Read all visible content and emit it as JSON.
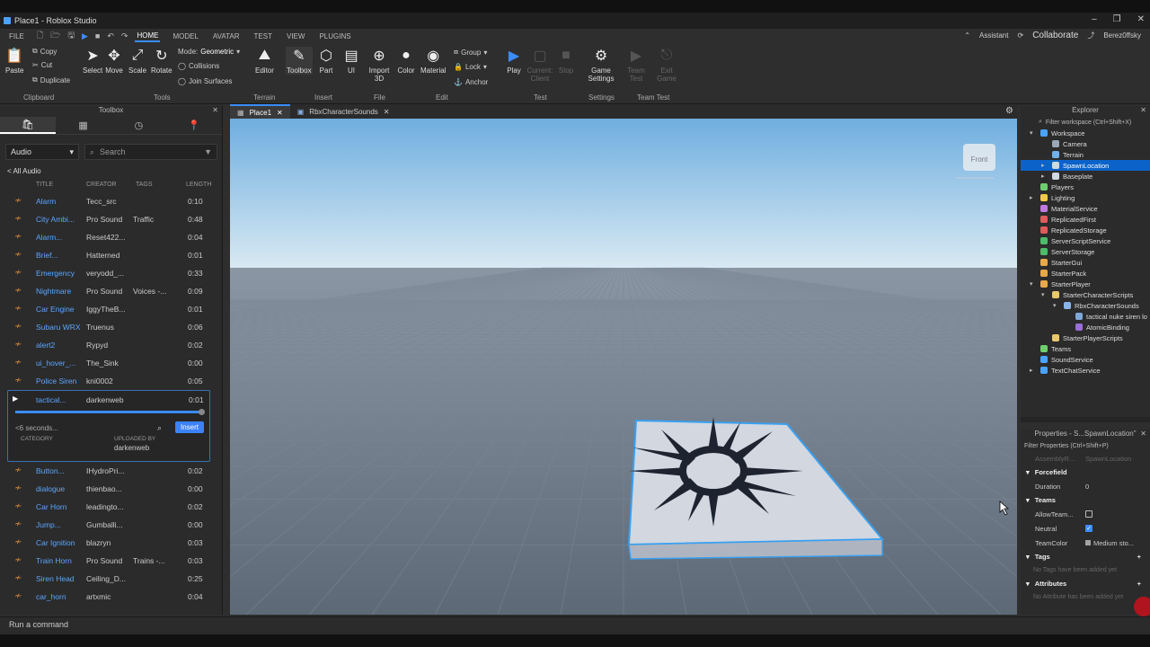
{
  "window": {
    "title": "Place1 - Roblox Studio"
  },
  "menu": {
    "items": [
      "FILE",
      "HOME",
      "MODEL",
      "AVATAR",
      "TEST",
      "VIEW",
      "PLUGINS"
    ],
    "active": "HOME",
    "assistant": "Assistant",
    "collaborate": "Collaborate",
    "user": "Berez0ffsky"
  },
  "ribbon": {
    "clipboard": {
      "paste": "Paste",
      "copy": "Copy",
      "cut": "Cut",
      "duplicate": "Duplicate",
      "group": "Clipboard"
    },
    "tools": {
      "select": "Select",
      "move": "Move",
      "scale": "Scale",
      "rotate": "Rotate",
      "mode_label": "Mode:",
      "mode_value": "Geometric",
      "collisions": "Collisions",
      "join_surfaces": "Join Surfaces",
      "group": "Tools"
    },
    "terrain": {
      "editor": "Editor",
      "group": "Terrain"
    },
    "insert": {
      "toolbox": "Toolbox",
      "part": "Part",
      "ui": "UI",
      "group": "Insert"
    },
    "file": {
      "import3d": "Import 3D",
      "group": "File"
    },
    "edit": {
      "color": "Color",
      "material": "Material",
      "group_btn": "Group",
      "lock": "Lock",
      "anchor": "Anchor",
      "group": "Edit"
    },
    "test": {
      "play": "Play",
      "current_client": "Current: Client",
      "stop": "Stop",
      "group": "Test"
    },
    "settings": {
      "game_settings": "Game Settings",
      "group": "Settings"
    },
    "team_test": {
      "team_test": "Team Test",
      "exit_game": "Exit Game",
      "group": "Team Test"
    }
  },
  "toolbox": {
    "title": "Toolbox",
    "category": "Audio",
    "search_placeholder": "Search",
    "breadcrumb": "< All Audio",
    "columns": [
      "TITLE",
      "CREATOR",
      "TAGS",
      "LENGTH"
    ],
    "rows_top": [
      {
        "title": "Alarm",
        "creator": "Tecc_src",
        "tags": "",
        "length": "0:10"
      },
      {
        "title": "City Ambi...",
        "creator": "Pro Sound",
        "tags": "Traffic",
        "length": "0:48"
      },
      {
        "title": "Alarm...",
        "creator": "Reset422...",
        "tags": "",
        "length": "0:04"
      },
      {
        "title": "Brief...",
        "creator": "Hatterned",
        "tags": "",
        "length": "0:01"
      },
      {
        "title": "Emergency",
        "creator": "veryodd_...",
        "tags": "",
        "length": "0:33"
      },
      {
        "title": "Nightmare",
        "creator": "Pro Sound",
        "tags": "Voices -...",
        "length": "0:09"
      },
      {
        "title": "Car Engine",
        "creator": "IggyTheB...",
        "tags": "",
        "length": "0:01"
      },
      {
        "title": "Subaru WRX",
        "creator": "Truenus",
        "tags": "",
        "length": "0:06"
      },
      {
        "title": "alert2",
        "creator": "Rypyd",
        "tags": "",
        "length": "0:02"
      },
      {
        "title": "ui_hover_...",
        "creator": "The_Sink",
        "tags": "",
        "length": "0:00"
      },
      {
        "title": "Police Siren",
        "creator": "kni0002",
        "tags": "",
        "length": "0:05"
      }
    ],
    "expanded": {
      "title": "tactical...",
      "creator": "darkenweb",
      "length": "0:01",
      "duration": "<6 seconds...",
      "insert": "Insert",
      "category_label": "CATEGORY",
      "uploaded_label": "UPLOADED BY",
      "uploaded_by": "darkenweb",
      "progress": 1.0
    },
    "rows_bottom": [
      {
        "title": "Button...",
        "creator": "IHydroPri...",
        "tags": "",
        "length": "0:02"
      },
      {
        "title": "dialogue",
        "creator": "thienbao...",
        "tags": "",
        "length": "0:00"
      },
      {
        "title": "Car Horn",
        "creator": "leadingto...",
        "tags": "",
        "length": "0:02"
      },
      {
        "title": "Jump...",
        "creator": "Gumballi...",
        "tags": "",
        "length": "0:00"
      },
      {
        "title": "Car Ignition",
        "creator": "blazryn",
        "tags": "",
        "length": "0:03"
      },
      {
        "title": "Train Horn",
        "creator": "Pro Sound",
        "tags": "Trains -...",
        "length": "0:03"
      },
      {
        "title": "Siren Head",
        "creator": "Ceiling_D...",
        "tags": "",
        "length": "0:25"
      },
      {
        "title": "car_horn",
        "creator": "artxmic",
        "tags": "",
        "length": "0:04"
      }
    ]
  },
  "doc_tabs": [
    "Place1",
    "RbxCharacterSounds"
  ],
  "viewport": {
    "view_cube": "Front"
  },
  "explorer": {
    "title": "Explorer",
    "filter": "Filter workspace (Ctrl+Shift+X)",
    "nodes": [
      {
        "label": "Workspace",
        "depth": 0,
        "arrow": "▾",
        "color": "#4aa3ff"
      },
      {
        "label": "Camera",
        "depth": 1,
        "arrow": "",
        "color": "#9aa7b5"
      },
      {
        "label": "Terrain",
        "depth": 1,
        "arrow": "",
        "color": "#6fb1e8"
      },
      {
        "label": "SpawnLocation",
        "depth": 1,
        "arrow": "▸",
        "color": "#cfd8e3",
        "selected": true
      },
      {
        "label": "Baseplate",
        "depth": 1,
        "arrow": "▸",
        "color": "#cfd8e3"
      },
      {
        "label": "Players",
        "depth": 0,
        "arrow": "",
        "color": "#6fcf6f"
      },
      {
        "label": "Lighting",
        "depth": 0,
        "arrow": "▸",
        "color": "#f2c84b"
      },
      {
        "label": "MaterialService",
        "depth": 0,
        "arrow": "",
        "color": "#c07adf"
      },
      {
        "label": "ReplicatedFirst",
        "depth": 0,
        "arrow": "",
        "color": "#e05b5b"
      },
      {
        "label": "ReplicatedStorage",
        "depth": 0,
        "arrow": "",
        "color": "#e05b5b"
      },
      {
        "label": "ServerScriptService",
        "depth": 0,
        "arrow": "",
        "color": "#4dbb6a"
      },
      {
        "label": "ServerStorage",
        "depth": 0,
        "arrow": "",
        "color": "#4dbb6a"
      },
      {
        "label": "StarterGui",
        "depth": 0,
        "arrow": "",
        "color": "#e8a94a"
      },
      {
        "label": "StarterPack",
        "depth": 0,
        "arrow": "",
        "color": "#e8a94a"
      },
      {
        "label": "StarterPlayer",
        "depth": 0,
        "arrow": "▾",
        "color": "#e8a94a"
      },
      {
        "label": "StarterCharacterScripts",
        "depth": 1,
        "arrow": "▾",
        "color": "#e8c96a"
      },
      {
        "label": "RbxCharacterSounds",
        "depth": 2,
        "arrow": "▾",
        "color": "#8ab4e8"
      },
      {
        "label": "tactical nuke siren lo",
        "depth": 3,
        "arrow": "",
        "color": "#7fa8d8"
      },
      {
        "label": "AtomicBinding",
        "depth": 3,
        "arrow": "",
        "color": "#9b6fd6"
      },
      {
        "label": "StarterPlayerScripts",
        "depth": 1,
        "arrow": "",
        "color": "#e8c96a"
      },
      {
        "label": "Teams",
        "depth": 0,
        "arrow": "",
        "color": "#6fcf6f"
      },
      {
        "label": "SoundService",
        "depth": 0,
        "arrow": "",
        "color": "#4aa3ff"
      },
      {
        "label": "TextChatService",
        "depth": 0,
        "arrow": "▸",
        "color": "#4aa3ff"
      }
    ]
  },
  "properties": {
    "title": "Properties - S...SpawnLocation\"",
    "filter": "Filter Properties (Ctrl+Shift+P)",
    "faded_row": {
      "k": "AssemblyR...",
      "v": "SpawnLocation"
    },
    "forcefield_section": "Forcefield",
    "duration_label": "Duration",
    "duration_value": "0",
    "teams_section": "Teams",
    "allow_team_label": "AllowTeam...",
    "neutral_label": "Neutral",
    "teamcolor_label": "TeamColor",
    "teamcolor_value": "Medium sto...",
    "tags_section": "Tags",
    "tags_empty": "No Tags have been added yet",
    "attributes_section": "Attributes",
    "attributes_empty": "No Attribute has been added yet"
  },
  "command_bar": {
    "placeholder": "Run a command"
  }
}
